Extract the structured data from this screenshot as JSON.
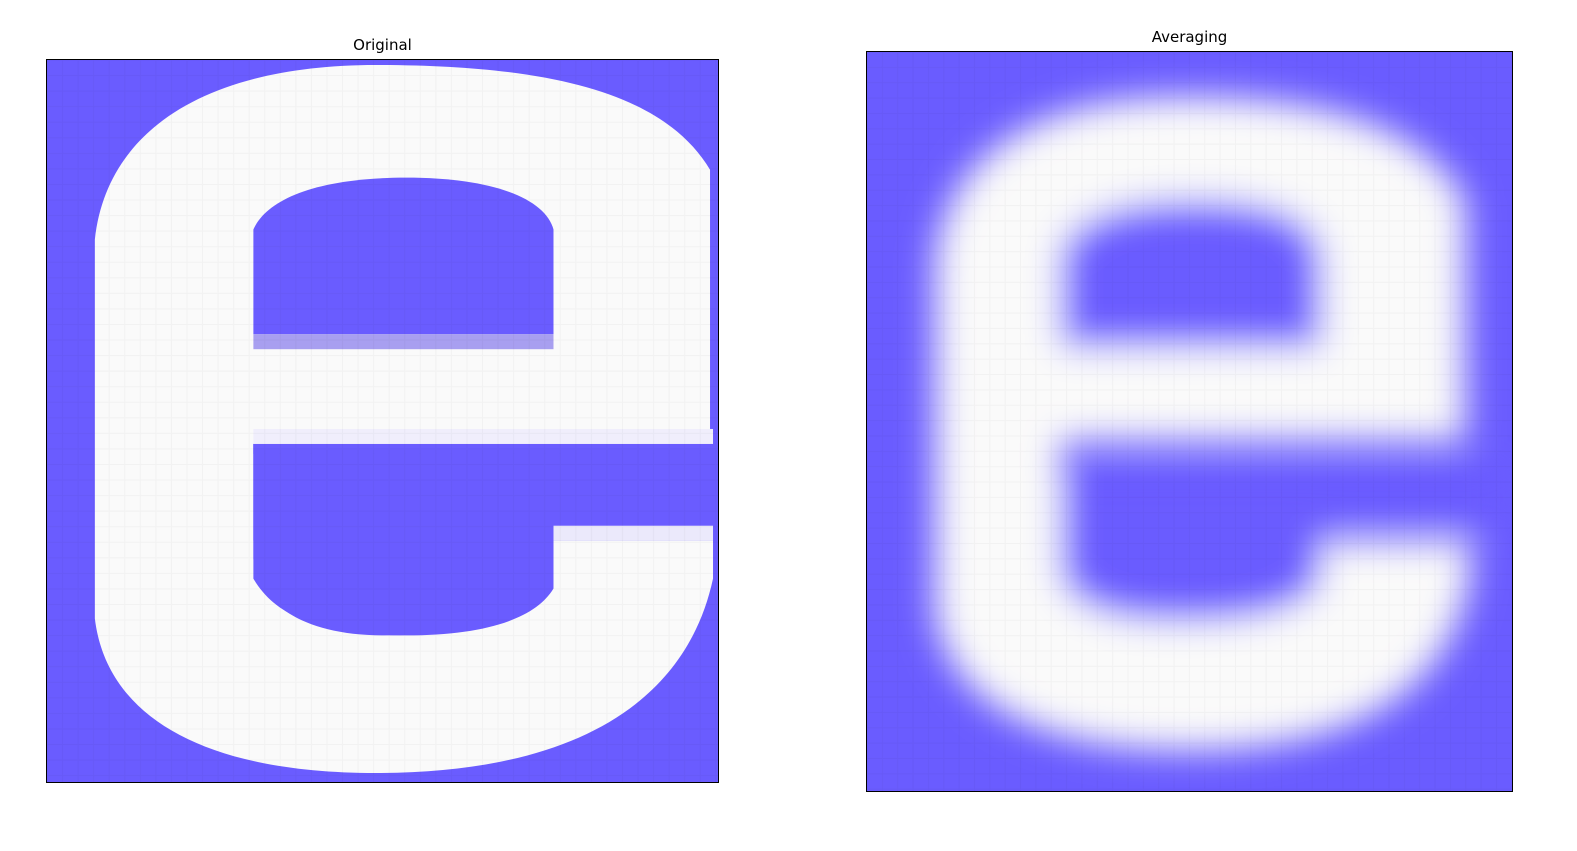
{
  "colors": {
    "background": "#6a5cff",
    "glyph": "#fafafa",
    "frame": "#000000"
  },
  "panels": [
    {
      "title": "Original"
    },
    {
      "title": "Averaging"
    }
  ]
}
